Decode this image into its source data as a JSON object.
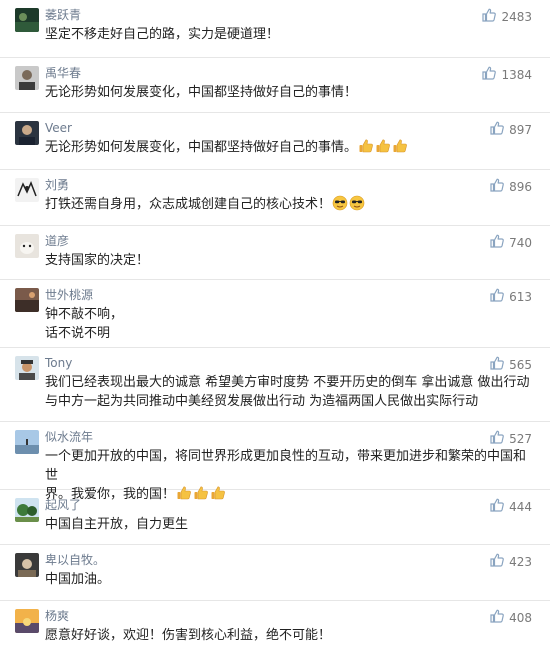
{
  "comments": [
    {
      "user": "萎跃青",
      "text": "坚定不移走好自己的路，实力是硬道理！",
      "likes": "2483",
      "avatar": "green-dark",
      "emoji": []
    },
    {
      "user": "禹华春",
      "text": "无论形势如何发展变化，中国都坚持做好自己的事情！",
      "likes": "1384",
      "avatar": "man-grey",
      "emoji": []
    },
    {
      "user": "Veer",
      "text": "无论形势如何发展变化，中国都坚持做好自己的事情。",
      "likes": "897",
      "avatar": "man-dark",
      "emoji": [
        "thumbs-up",
        "thumbs-up",
        "thumbs-up"
      ]
    },
    {
      "user": "刘勇",
      "text": "打铁还需自身用，众志成城创建自己的核心技术！",
      "likes": "896",
      "avatar": "sketch",
      "emoji": [
        "sunglasses-face",
        "sunglasses-face"
      ]
    },
    {
      "user": "道彦",
      "text": "支持国家的决定！",
      "likes": "740",
      "avatar": "dog",
      "emoji": []
    },
    {
      "user": "世外桃源",
      "text": "钟不敲不响，\n话不说不明",
      "likes": "613",
      "avatar": "landscape",
      "emoji": []
    },
    {
      "user": "Tony",
      "text": "我们已经表现出最大的诚意 希望美方审时度势 不要开历史的倒车 拿出诚意 做出行动\n与中方一起为共同推动中美经贸发展做出行动 为造福两国人民做出实际行动",
      "likes": "565",
      "avatar": "man-cap",
      "emoji": []
    },
    {
      "user": "似水流年",
      "text": "一个更加开放的中国，将同世界形成更加良性的互动，带来更加进步和繁荣的中国和世\n界。我爱你，我的国！",
      "likes": "527",
      "avatar": "sky",
      "emoji": [
        "thumbs-up",
        "thumbs-up",
        "thumbs-up"
      ]
    },
    {
      "user": "起风了",
      "text": "中国自主开放，自力更生",
      "likes": "444",
      "avatar": "trees",
      "emoji": []
    },
    {
      "user": "卑以自牧。",
      "text": "中国加油。",
      "likes": "423",
      "avatar": "photo",
      "emoji": []
    },
    {
      "user": "杨爽",
      "text": "愿意好好谈，欢迎！伤害到核心利益，绝不可能！",
      "likes": "408",
      "avatar": "sunset",
      "emoji": []
    }
  ],
  "colors": {
    "name": "#6d7b8e",
    "like_icon": "#8aa4c0",
    "divider": "#e6e6e6"
  }
}
